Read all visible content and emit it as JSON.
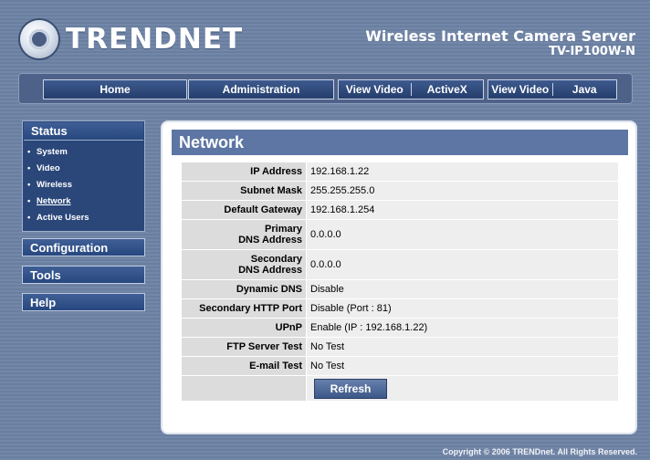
{
  "header": {
    "brand": "TRENDNET",
    "product_line1": "Wireless Internet Camera Server",
    "product_line2": "TV-IP100W-N"
  },
  "nav": {
    "home": "Home",
    "administration": "Administration",
    "view_video_activex": [
      "View Video",
      "ActiveX"
    ],
    "view_video_java": [
      "View Video",
      "Java"
    ]
  },
  "sidebar": {
    "status": "Status",
    "items": [
      {
        "label": "System"
      },
      {
        "label": "Video"
      },
      {
        "label": "Wireless"
      },
      {
        "label": "Network"
      },
      {
        "label": "Active Users"
      }
    ],
    "bullet": "•",
    "configuration": "Configuration",
    "tools": "Tools",
    "help": "Help"
  },
  "page": {
    "title": "Network",
    "rows": [
      {
        "label": "IP Address",
        "value": "192.168.1.22"
      },
      {
        "label": "Subnet Mask",
        "value": "255.255.255.0"
      },
      {
        "label": "Default Gateway",
        "value": "192.168.1.254"
      },
      {
        "label": [
          "Primary",
          "DNS Address"
        ],
        "value": "0.0.0.0"
      },
      {
        "label": [
          "Secondary",
          "DNS Address"
        ],
        "value": "0.0.0.0"
      },
      {
        "label": "Dynamic DNS",
        "value": "Disable"
      },
      {
        "label": "Secondary HTTP Port",
        "value": "Disable (Port : 81)"
      },
      {
        "label": "UPnP",
        "value": "Enable (IP : 192.168.1.22)"
      },
      {
        "label": "FTP Server Test",
        "value": "No Test"
      },
      {
        "label": "E-mail Test",
        "value": "No Test"
      }
    ],
    "refresh": "Refresh"
  },
  "footer": {
    "copyright": "Copyright © 2006 TRENDnet. All Rights Reserved."
  }
}
